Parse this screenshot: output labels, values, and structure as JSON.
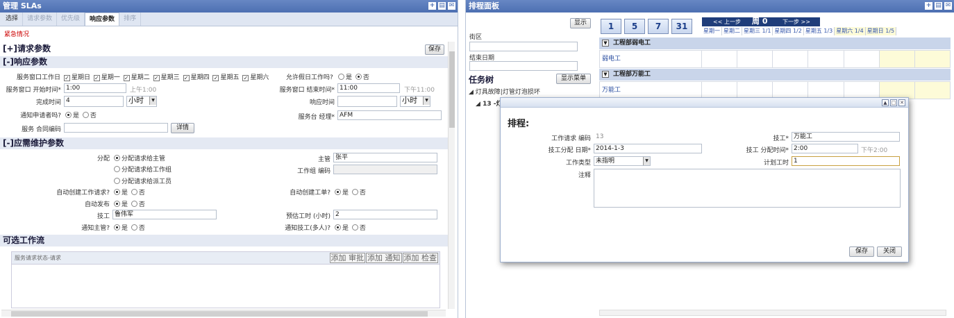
{
  "left": {
    "title": "管理 SLAs",
    "tabs": [
      "选择",
      "请求参数",
      "优先级",
      "响应参数",
      "排序"
    ],
    "alert": "紧急情况",
    "save_label": "保存",
    "request_params_label": "[+]请求参数",
    "response_params_label": "[-]响应参数",
    "workdays_label": "服务窗口工作日",
    "weekdays": [
      "星期日",
      "星期一",
      "星期二",
      "星期三",
      "星期四",
      "星期五",
      "星期六"
    ],
    "holiday_label": "允许假日工作吗?",
    "yes": "是",
    "no": "否",
    "start_label": "服务窗口 开始时间*",
    "start_value": "1:00",
    "start_hint": "上午1:00",
    "end_label": "服务窗口 结束时间*",
    "end_value": "11:00",
    "end_hint": "下午11:00",
    "complete_label": "完成时间",
    "complete_value": "4",
    "unit_hour": "小时",
    "response_label": "响应时间",
    "notify_requester_label": "通知申请者吗?",
    "desk_manager_label": "服务台 经理*",
    "desk_manager_value": "AFM",
    "contract_label": "服务 合同编码",
    "detail_label": "详情",
    "maint_label": "[-]应需维护参数",
    "assign_label": "分配",
    "assign_options": [
      "分配请求给主管",
      "分配请求给工作组",
      "分配请求给派工员"
    ],
    "supervisor_label": "主管",
    "supervisor_value": "张平",
    "workgroup_label": "工作组 编码",
    "auto_create_request_label": "自动创建工作请求?",
    "auto_create_order_label": "自动创建工单?",
    "auto_issue_label": "自动发布",
    "tech_label": "技工",
    "tech_value": "鲁伟军",
    "est_hours_label": "预估工时 (小时)",
    "est_hours_value": "2",
    "notify_supervisor_label": "通知主管?",
    "notify_tech_label": "通知技工(多人)?",
    "workflow_label": "可选工作流",
    "workflow_col": "服务请求状态-请求",
    "workflow_buttons": [
      "添加 审批",
      "添加 通知",
      "添加 检查"
    ]
  },
  "right": {
    "title": "排程面板",
    "show_label": "显示",
    "street_label": "街区",
    "end_date_label": "结束日期",
    "task_tree_label": "任务树",
    "show_menu_label": "显示菜单",
    "tree_item_1": "灯具故障|灯管灯泡损坏",
    "tree_item_2": "13 -灯",
    "day_buttons": [
      "1",
      "5",
      "7",
      "31"
    ],
    "prev_label": "<< 上一步",
    "week_label": "周 0",
    "next_label": "下一步 >>",
    "weekdays": [
      "星期一",
      "星期二",
      "星期三 1/1",
      "星期四 1/2",
      "星期五 1/3",
      "星期六 1/4",
      "星期日 1/5"
    ],
    "groups": [
      {
        "header": "工程部弱电工",
        "row": "弱电工"
      },
      {
        "header": "工程部万能工",
        "row": "万能工"
      }
    ]
  },
  "modal": {
    "title": "排程:",
    "request_code_label": "工作请求 编码",
    "request_code_value": "13",
    "tech_label": "技工*",
    "tech_value": "万能工",
    "assign_date_label": "技工分配 日期*",
    "assign_date_value": "2014-1-3",
    "assign_time_label": "技工 分配时间*",
    "assign_time_value": "2:00",
    "assign_time_hint": "下午2:00",
    "work_type_label": "工作类型",
    "work_type_value": "未指明",
    "planned_hours_label": "计划工时",
    "planned_hours_value": "1",
    "notes_label": "注释",
    "save_label": "保存",
    "close_label": "关闭"
  }
}
